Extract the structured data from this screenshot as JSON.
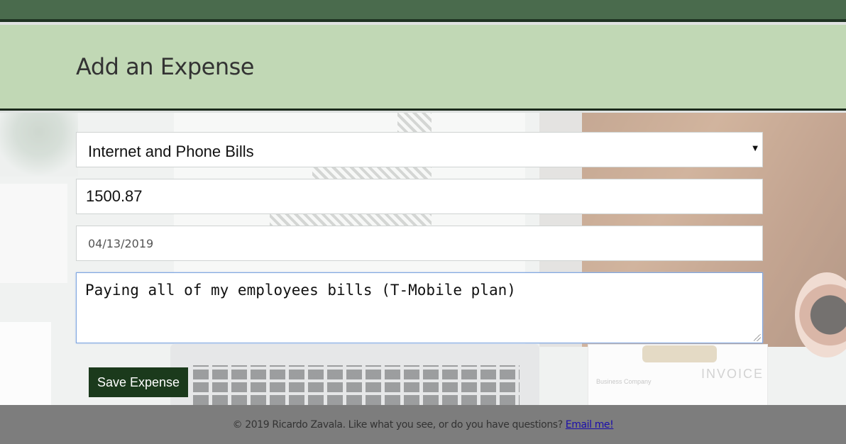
{
  "header": {
    "title": "Add an Expense"
  },
  "form": {
    "category": {
      "selected": "Internet and Phone Bills"
    },
    "amount": {
      "value": "1500.87"
    },
    "date": {
      "value": "04/13/2019"
    },
    "note": {
      "value": "Paying all of my employees bills (T-Mobile plan)"
    },
    "save_label": "Save Expense"
  },
  "footer": {
    "text": "© 2019 Ricardo Zavala. Like what you see, or do you have questions?",
    "link_label": "Email me!"
  },
  "background": {
    "invoice_title": "INVOICE",
    "invoice_company": "Business Company"
  },
  "colors": {
    "topbar": "#4a6b4d",
    "header": "#c1d8b5",
    "button": "#1b3a1c",
    "footer": "#7d7d7d"
  }
}
